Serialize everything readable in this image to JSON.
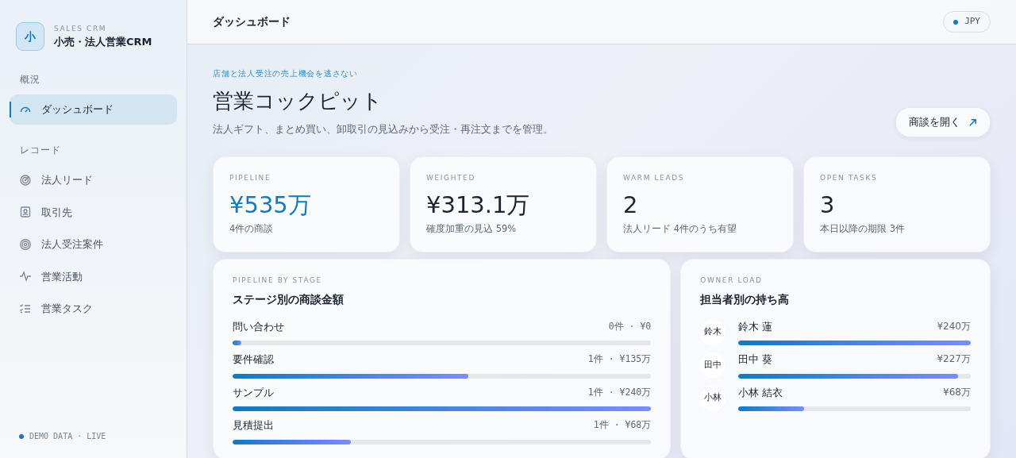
{
  "sidebar": {
    "logo": "小",
    "brand_kicker": "SALES CRM",
    "brand_name": "小売・法人営業CRM",
    "sections": [
      {
        "label": "概況",
        "items": [
          {
            "label": "ダッシュボード",
            "kind": "gauge",
            "selected": true
          }
        ]
      },
      {
        "label": "レコード",
        "items": [
          {
            "label": "法人リード",
            "kind": "radar",
            "selected": false
          },
          {
            "label": "取引先",
            "kind": "contact",
            "selected": false
          },
          {
            "label": "法人受注案件",
            "kind": "target",
            "selected": false
          },
          {
            "label": "営業活動",
            "kind": "pulse",
            "selected": false
          },
          {
            "label": "営業タスク",
            "kind": "checklist",
            "selected": false
          }
        ]
      }
    ],
    "footer": "DEMO DATA · LIVE"
  },
  "header": {
    "title": "ダッシュボード",
    "currency": "JPY"
  },
  "hero": {
    "kicker": "店舗と法人受注の売上機会を逃さない",
    "title": "営業コックピット",
    "subtitle": "法人ギフト、まとめ買い、卸取引の見込みから受注・再注文までを管理。",
    "button": "商談を開く"
  },
  "kpis": [
    {
      "label": "PIPELINE",
      "value": "¥535万",
      "note": "4件の商談",
      "accent": true
    },
    {
      "label": "WEIGHTED",
      "value": "¥313.1万",
      "note": "確度加重の見込 59%",
      "accent": false
    },
    {
      "label": "WARM LEADS",
      "value": "2",
      "note": "法人リード 4件のうち有望",
      "accent": false
    },
    {
      "label": "OPEN TASKS",
      "value": "3",
      "note": "本日以降の期限 3件",
      "accent": false
    }
  ],
  "stages": {
    "kicker": "PIPELINE BY STAGE",
    "title": "ステージ別の商談金額",
    "rows": [
      {
        "name": "問い合わせ",
        "reading": "0件 · ¥0",
        "level": 0.02
      },
      {
        "name": "要件確認",
        "reading": "1件 · ¥135万",
        "level": 0.5625
      },
      {
        "name": "サンプル",
        "reading": "1件 · ¥240万",
        "level": 1
      },
      {
        "name": "見積提出",
        "reading": "1件 · ¥68万",
        "level": 0.283
      }
    ]
  },
  "owners": {
    "kicker": "OWNER LOAD",
    "title": "担当者別の持ち高",
    "rows": [
      {
        "initials": "鈴木",
        "name": "鈴木 蓮",
        "amount": "¥240万",
        "level": 1
      },
      {
        "initials": "田中",
        "name": "田中 葵",
        "amount": "¥227万",
        "level": 0.946
      },
      {
        "initials": "小林",
        "name": "小林 結衣",
        "amount": "¥68万",
        "level": 0.283
      }
    ]
  }
}
